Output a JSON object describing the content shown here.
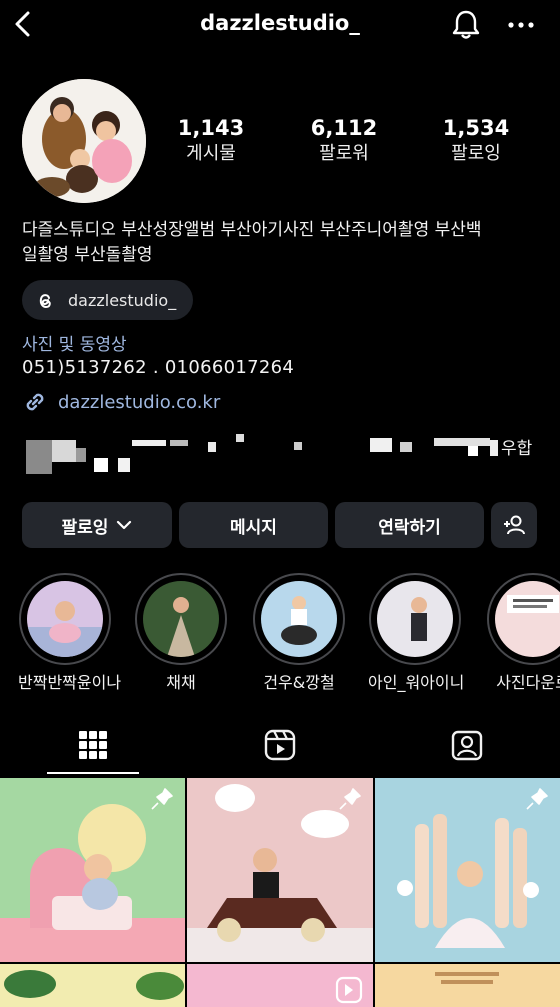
{
  "header": {
    "username": "dazzlestudio_"
  },
  "profile": {
    "stats": [
      {
        "value": "1,143",
        "label": "게시물"
      },
      {
        "value": "6,112",
        "label": "팔로워"
      },
      {
        "value": "1,534",
        "label": "팔로잉"
      }
    ],
    "bio_line1": "다즐스튜디오 부산성장앨범 부산아기사진 부산주니어촬영 부산백",
    "bio_line2": "일촬영 부산돌촬영",
    "threads_handle": "dazzlestudio_",
    "category": "사진 및 동영상",
    "phone": "051)5137262 . 01066017264",
    "website": "dazzlestudio.co.kr",
    "obscured_tail": "우합"
  },
  "actions": {
    "following": "팔로잉",
    "message": "메시지",
    "contact": "연락하기"
  },
  "highlights": [
    {
      "label": "반짝반짝윤이나"
    },
    {
      "label": "채채"
    },
    {
      "label": "건우&깡철"
    },
    {
      "label": "아인_워아이니"
    },
    {
      "label": "사진다운로"
    }
  ],
  "colors": {
    "background": "#000000",
    "button": "#24272d",
    "link": "#9fb7df"
  }
}
